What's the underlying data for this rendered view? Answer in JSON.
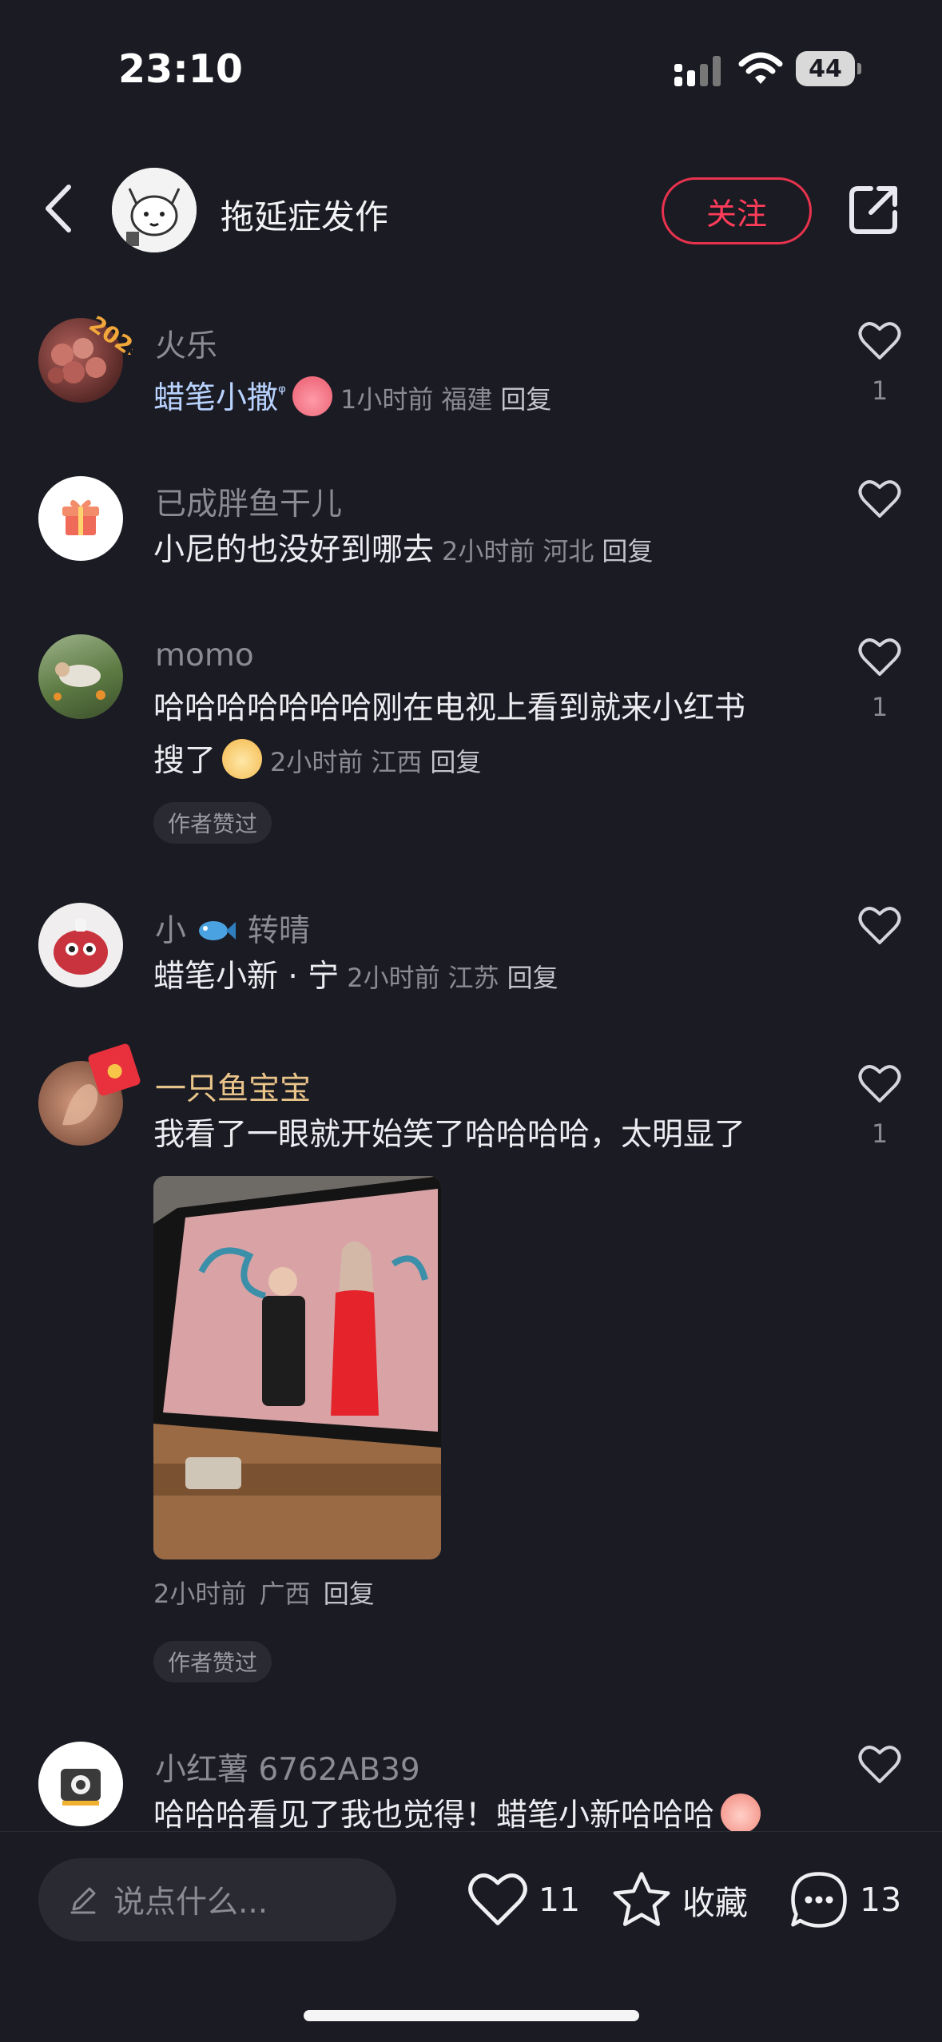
{
  "status_bar": {
    "time": "23:10",
    "battery": "44"
  },
  "header": {
    "author_name": "拖延症发作",
    "follow_label": "关注"
  },
  "comments": [
    {
      "name": "火乐",
      "text": "蜡笔小撒",
      "search_mark": "ᵠ",
      "time": "1小时前",
      "location": "福建",
      "reply": "回复",
      "likes": "1"
    },
    {
      "name": "已成胖鱼干儿",
      "text": "小尼的也没好到哪去",
      "time": "2小时前",
      "location": "河北",
      "reply": "回复",
      "likes": ""
    },
    {
      "name": "momo",
      "text_line1": "哈哈哈哈哈哈哈刚在电视上看到就来小红书",
      "text_line2": "搜了",
      "time": "2小时前",
      "location": "江西",
      "reply": "回复",
      "likes": "1",
      "badge": "作者赞过"
    },
    {
      "name_prefix": "小",
      "name_suffix": "转晴",
      "text": "蜡笔小新 · 宁",
      "time": "2小时前",
      "location": "江苏",
      "reply": "回复",
      "likes": ""
    },
    {
      "name": "一只鱼宝宝",
      "text": "我看了一眼就开始笑了哈哈哈哈，太明显了",
      "time": "2小时前",
      "location": "广西",
      "reply": "回复",
      "likes": "1",
      "badge": "作者赞过"
    },
    {
      "name": "小红薯 6762AB39",
      "text": "哈哈哈看见了我也觉得！蜡笔小新哈哈哈",
      "likes": ""
    }
  ],
  "bottom_bar": {
    "input_placeholder": "说点什么...",
    "like_count": "11",
    "collect_label": "收藏",
    "comment_count": "13"
  },
  "colors": {
    "accent": "#ff3d5a",
    "background": "#1b1b23",
    "vip_name": "#e9c48a"
  }
}
